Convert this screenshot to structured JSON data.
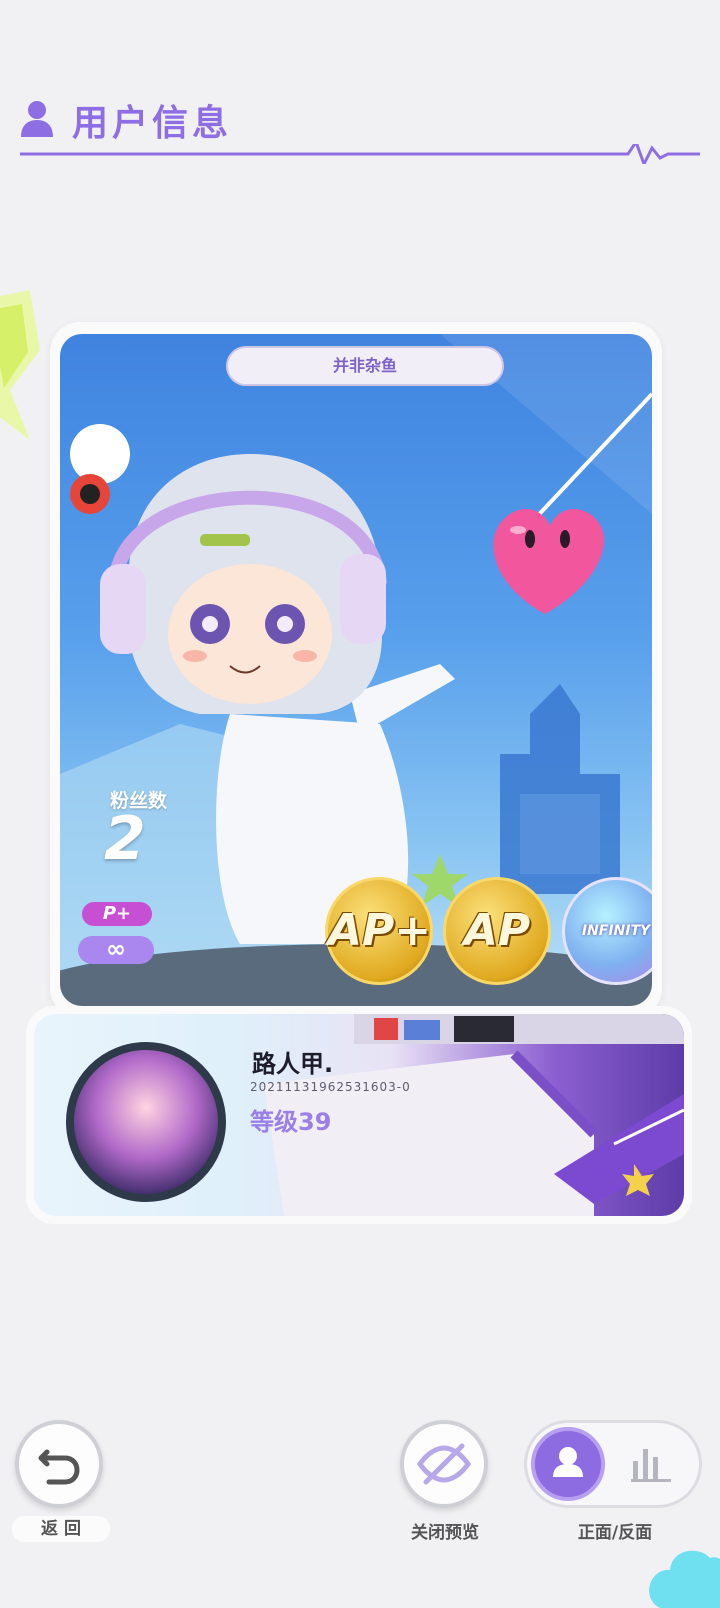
{
  "header": {
    "title": "用户信息",
    "icon": "user-icon"
  },
  "card": {
    "title": "并非杂鱼",
    "fans_label": "粉丝数",
    "fans_value": "2",
    "badges": {
      "p_plus": "P+",
      "infinity": "∞"
    },
    "medals": [
      "AP+",
      "AP",
      "INFINITY"
    ]
  },
  "profile": {
    "name": "路人甲.",
    "id": "20211131962531603-0",
    "level": "等级39"
  },
  "controls": {
    "back_label": "返 回",
    "preview_label": "关闭预览",
    "toggle_label": "正面/反面"
  },
  "colors": {
    "accent": "#8e6ee3",
    "background": "#f1f1f4"
  }
}
